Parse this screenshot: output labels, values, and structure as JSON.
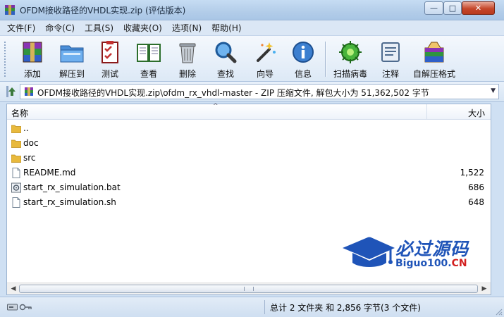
{
  "window": {
    "title": "OFDM接收路径的VHDL实现.zip (评估版本)",
    "min_glyph": "—",
    "max_glyph": "□",
    "close_glyph": "✕"
  },
  "menu": {
    "items": [
      "文件(F)",
      "命令(C)",
      "工具(S)",
      "收藏夹(O)",
      "选项(N)",
      "帮助(H)"
    ]
  },
  "toolbar": {
    "buttons": [
      {
        "label": "添加",
        "icon": "add-archive-icon"
      },
      {
        "label": "解压到",
        "icon": "extract-folder-icon"
      },
      {
        "label": "测试",
        "icon": "test-checklist-icon"
      },
      {
        "label": "查看",
        "icon": "view-book-icon"
      },
      {
        "label": "删除",
        "icon": "trash-icon"
      },
      {
        "label": "查找",
        "icon": "magnifier-icon"
      },
      {
        "label": "向导",
        "icon": "wizard-wand-icon"
      },
      {
        "label": "信息",
        "icon": "info-icon"
      },
      {
        "label": "扫描病毒",
        "icon": "virus-scan-icon"
      },
      {
        "label": "注释",
        "icon": "comment-icon"
      },
      {
        "label": "自解压格式",
        "icon": "sfx-archive-icon"
      }
    ]
  },
  "address": {
    "path": "OFDM接收路径的VHDL实现.zip\\ofdm_rx_vhdl-master - ZIP 压缩文件, 解包大小为 51,362,502 字节"
  },
  "list": {
    "headers": {
      "name": "名称",
      "size": "大小"
    },
    "rows": [
      {
        "name": "..",
        "size": "",
        "type": "folder"
      },
      {
        "name": "doc",
        "size": "",
        "type": "folder"
      },
      {
        "name": "src",
        "size": "",
        "type": "folder"
      },
      {
        "name": "README.md",
        "size": "1,522",
        "type": "file"
      },
      {
        "name": "start_rx_simulation.bat",
        "size": "686",
        "type": "bat"
      },
      {
        "name": "start_rx_simulation.sh",
        "size": "648",
        "type": "file"
      }
    ]
  },
  "watermark": {
    "cn": "必过源码",
    "en_main": "Biguo100.",
    "en_suffix": "CN"
  },
  "status": {
    "summary": "总计 2 文件夹 和 2,856 字节(3 个文件)"
  },
  "colors": {
    "accent": "#1f54b8",
    "folder": "#e8b93c",
    "close_red": "#c5472b"
  }
}
